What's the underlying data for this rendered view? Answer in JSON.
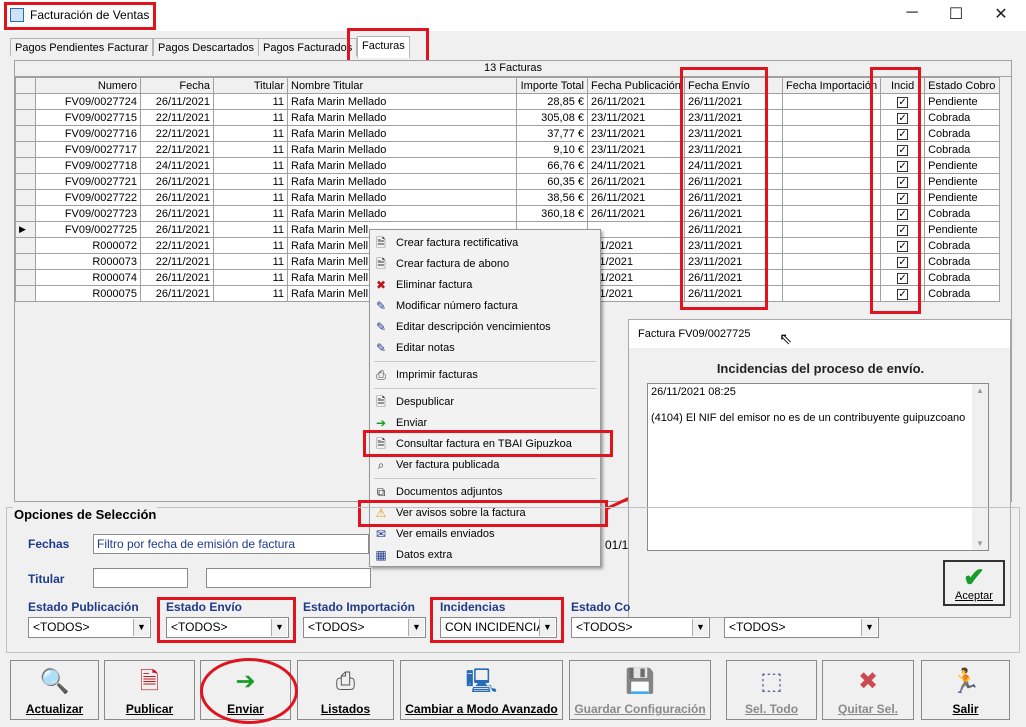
{
  "window": {
    "title": "Facturación de Ventas",
    "minimize": "─",
    "maximize": "☐",
    "close": "✕"
  },
  "tabs": [
    "Pagos Pendientes Facturar",
    "Pagos Descartados",
    "Pagos Facturados",
    "Facturas"
  ],
  "grid": {
    "caption": "13 Facturas",
    "columns": [
      "Numero",
      "Fecha",
      "Titular",
      "Nombre Titular",
      "Importe Total",
      "Fecha Publicación",
      "Fecha Envío",
      "Fecha Importación",
      "Incid",
      "Estado Cobro"
    ],
    "rows": [
      {
        "numero": "FV09/0027724",
        "fecha": "26/11/2021",
        "titular": "11",
        "nombre": "Rafa Marin Mellado",
        "importe": "28,85 €",
        "fpub": "26/11/2021",
        "fenv": "26/11/2021",
        "fimp": "",
        "incid": true,
        "estado": "Pendiente"
      },
      {
        "numero": "FV09/0027715",
        "fecha": "22/11/2021",
        "titular": "11",
        "nombre": "Rafa Marin Mellado",
        "importe": "305,08 €",
        "fpub": "23/11/2021",
        "fenv": "23/11/2021",
        "fimp": "",
        "incid": true,
        "estado": "Cobrada"
      },
      {
        "numero": "FV09/0027716",
        "fecha": "22/11/2021",
        "titular": "11",
        "nombre": "Rafa Marin Mellado",
        "importe": "37,77 €",
        "fpub": "23/11/2021",
        "fenv": "23/11/2021",
        "fimp": "",
        "incid": true,
        "estado": "Cobrada"
      },
      {
        "numero": "FV09/0027717",
        "fecha": "22/11/2021",
        "titular": "11",
        "nombre": "Rafa Marin Mellado",
        "importe": "9,10 €",
        "fpub": "23/11/2021",
        "fenv": "23/11/2021",
        "fimp": "",
        "incid": true,
        "estado": "Cobrada"
      },
      {
        "numero": "FV09/0027718",
        "fecha": "24/11/2021",
        "titular": "11",
        "nombre": "Rafa Marin Mellado",
        "importe": "66,76 €",
        "fpub": "24/11/2021",
        "fenv": "24/11/2021",
        "fimp": "",
        "incid": true,
        "estado": "Pendiente"
      },
      {
        "numero": "FV09/0027721",
        "fecha": "26/11/2021",
        "titular": "11",
        "nombre": "Rafa Marin Mellado",
        "importe": "60,35 €",
        "fpub": "26/11/2021",
        "fenv": "26/11/2021",
        "fimp": "",
        "incid": true,
        "estado": "Pendiente"
      },
      {
        "numero": "FV09/0027722",
        "fecha": "26/11/2021",
        "titular": "11",
        "nombre": "Rafa Marin Mellado",
        "importe": "38,56 €",
        "fpub": "26/11/2021",
        "fenv": "26/11/2021",
        "fimp": "",
        "incid": true,
        "estado": "Pendiente"
      },
      {
        "numero": "FV09/0027723",
        "fecha": "26/11/2021",
        "titular": "11",
        "nombre": "Rafa Marin Mellado",
        "importe": "360,18 €",
        "fpub": "26/11/2021",
        "fenv": "26/11/2021",
        "fimp": "",
        "incid": true,
        "estado": "Cobrada"
      },
      {
        "numero": "FV09/0027725",
        "fecha": "26/11/2021",
        "titular": "11",
        "nombre": "Rafa Marin Mell",
        "importe": "",
        "fpub": "",
        "fenv": "26/11/2021",
        "fimp": "",
        "incid": true,
        "estado": "Pendiente",
        "selected": true
      },
      {
        "numero": "R000072",
        "fecha": "22/11/2021",
        "titular": "11",
        "nombre": "Rafa Marin Mell",
        "importe": "",
        "fpub": "/11/2021",
        "fenv": "23/11/2021",
        "fimp": "",
        "incid": true,
        "estado": "Cobrada"
      },
      {
        "numero": "R000073",
        "fecha": "22/11/2021",
        "titular": "11",
        "nombre": "Rafa Marin Mell",
        "importe": "",
        "fpub": "/11/2021",
        "fenv": "23/11/2021",
        "fimp": "",
        "incid": true,
        "estado": "Cobrada"
      },
      {
        "numero": "R000074",
        "fecha": "26/11/2021",
        "titular": "11",
        "nombre": "Rafa Marin Mell",
        "importe": "",
        "fpub": "/11/2021",
        "fenv": "26/11/2021",
        "fimp": "",
        "incid": true,
        "estado": "Cobrada"
      },
      {
        "numero": "R000075",
        "fecha": "26/11/2021",
        "titular": "11",
        "nombre": "Rafa Marin Mell",
        "importe": "",
        "fpub": "/11/2021",
        "fenv": "26/11/2021",
        "fimp": "",
        "incid": true,
        "estado": "Cobrada"
      }
    ],
    "selected_marker": "▶"
  },
  "context_menu": [
    {
      "label": "Crear factura rectificativa",
      "icon": "document-icon"
    },
    {
      "label": "Crear factura de abono",
      "icon": "document-icon"
    },
    {
      "label": "Eliminar factura",
      "icon": "delete-icon"
    },
    {
      "label": "Modificar número factura",
      "icon": "pen-icon"
    },
    {
      "label": "Editar descripción vencimientos",
      "icon": "pen-icon"
    },
    {
      "label": "Editar notas",
      "icon": "pen-icon"
    },
    {
      "label": "Imprimir facturas",
      "icon": "printer-icon"
    },
    {
      "label": "Despublicar",
      "icon": "document-icon"
    },
    {
      "label": "Enviar",
      "icon": "send-icon"
    },
    {
      "label": "Consultar factura en TBAI Gipuzkoa",
      "icon": "document-icon"
    },
    {
      "label": "Ver factura publicada",
      "icon": "magnifier-icon"
    },
    {
      "label": "Documentos adjuntos",
      "icon": "attachment-icon"
    },
    {
      "label": "Ver avisos sobre la factura",
      "icon": "warning-icon"
    },
    {
      "label": "Ver emails enviados",
      "icon": "email-icon"
    },
    {
      "label": "Datos extra",
      "icon": "grid-icon"
    }
  ],
  "popup": {
    "title": "Factura FV09/0027725",
    "heading": "Incidencias del proceso de envío.",
    "date": "26/11/2021 08:25",
    "message": "(4104) El NIF del emisor no es de un contribuyente guipuzcoano",
    "ok_label": "Aceptar"
  },
  "options": {
    "title": "Opciones de Selección",
    "fechas_label": "Fechas",
    "fechas_value": "Filtro por fecha de emisión de factura",
    "fecha_desde": "01/1",
    "titular_label": "Titular",
    "titular_value": "",
    "estado_publicacion_label": "Estado Publicación",
    "estado_publicacion": "<TODOS>",
    "estado_envio_label": "Estado Envío",
    "estado_envio": "<TODOS>",
    "estado_importacion_label": "Estado Importación",
    "estado_importacion": "<TODOS>",
    "incidencias_label": "Incidencias",
    "incidencias": "CON INCIDENCIA",
    "estado_cobro_label": "Estado Co",
    "estado_cobro": "<TODOS>",
    "extra_combo": "<TODOS>"
  },
  "toolbar": [
    {
      "label": "Actualizar",
      "icon": "refresh-icon",
      "enabled": true
    },
    {
      "label": "Publicar",
      "icon": "publish-icon",
      "enabled": true
    },
    {
      "label": "Enviar",
      "icon": "send-icon",
      "enabled": true
    },
    {
      "label": "Listados",
      "icon": "printer-icon",
      "enabled": true
    },
    {
      "label": "Cambiar a Modo Avanzado",
      "icon": "computer-icon",
      "enabled": true
    },
    {
      "label": "Guardar Configuración",
      "icon": "save-icon",
      "enabled": false
    },
    {
      "label": "Sel. Todo",
      "icon": "select-all-icon",
      "enabled": false
    },
    {
      "label": "Quitar Sel.",
      "icon": "deselect-icon",
      "enabled": false
    },
    {
      "label": "Salir",
      "icon": "exit-icon",
      "enabled": true
    }
  ]
}
